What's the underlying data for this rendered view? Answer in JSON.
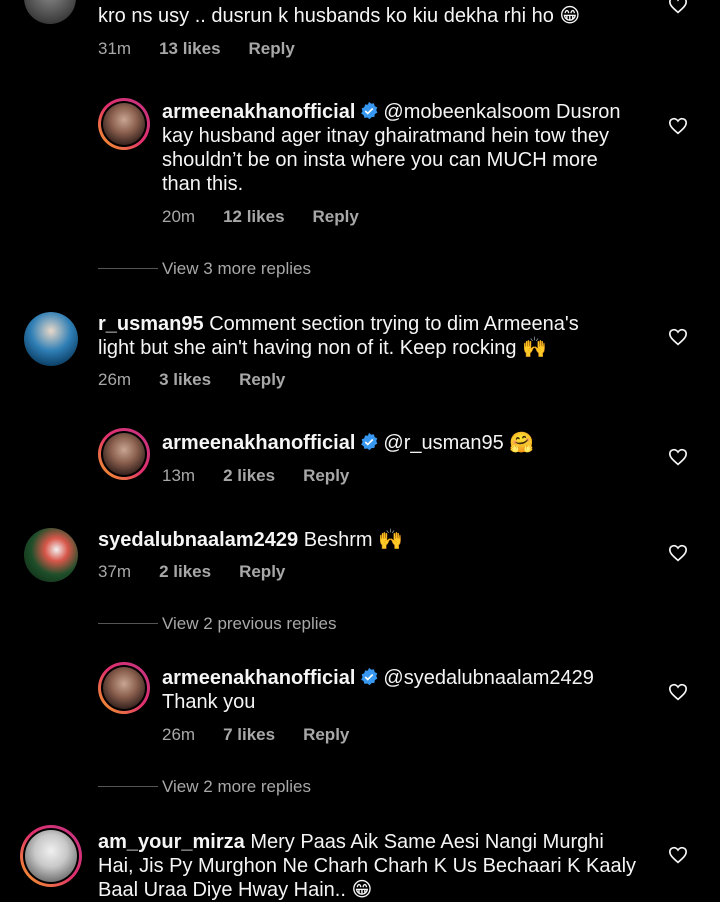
{
  "comments": [
    {
      "id": "c0",
      "username": "",
      "text": "kro ns usy .. dusrun k husbands ko kiu dekha rhi ho",
      "emoji": "😁",
      "time": "31m",
      "likes": "13 likes",
      "reply": "Reply"
    },
    {
      "id": "r0",
      "username": "armeenakhanofficial",
      "verified": true,
      "mention": "@mobeenkalsoom",
      "text_lines": [
        "Dusron",
        "kay husband ager itnay ghairatmand hein tow they",
        "shouldn’t be on insta where you can MUCH more",
        "than this."
      ],
      "time": "20m",
      "likes": "12 likes",
      "reply": "Reply",
      "view_more": "View 3 more replies"
    },
    {
      "id": "c1",
      "username": "r_usman95",
      "text_lines": [
        "Comment section trying to dim  Armeena's",
        "light but she ain't having non of it. Keep rocking"
      ],
      "emoji": "🙌",
      "time": "26m",
      "likes": "3 likes",
      "reply": "Reply"
    },
    {
      "id": "r1",
      "username": "armeenakhanofficial",
      "verified": true,
      "mention": "@r_usman95",
      "emoji": "🤗",
      "time": "13m",
      "likes": "2 likes",
      "reply": "Reply"
    },
    {
      "id": "c2",
      "username": "syedalubnaalam2429",
      "text": "Beshrm",
      "emoji": "🙌",
      "time": "37m",
      "likes": "2 likes",
      "reply": "Reply",
      "view_prev": "View 2 previous replies"
    },
    {
      "id": "r2",
      "username": "armeenakhanofficial",
      "verified": true,
      "mention": "@syedalubnaalam2429",
      "text": "Thank you",
      "time": "26m",
      "likes": "7 likes",
      "reply": "Reply",
      "view_more": "View 2 more replies"
    },
    {
      "id": "c3",
      "username": "am_your_mirza",
      "text_lines": [
        "Mery Paas Aik Same Aesi Nangi Murghi",
        "Hai, Jis Py Murghon Ne Charh Charh K Us Bechaari K Kaaly",
        "Baal Uraa Diye Hway Hain.."
      ],
      "emoji": "😁"
    }
  ],
  "icons": {
    "heart": "heart-outline-icon",
    "verified": "verified-badge-icon"
  },
  "colors": {
    "background": "#000000",
    "text": "#f5f5f5",
    "meta": "#a8a8a8",
    "verified": "#3897f0"
  }
}
